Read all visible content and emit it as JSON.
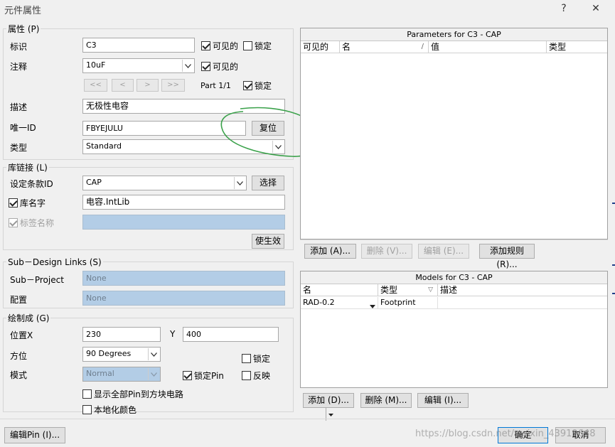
{
  "window": {
    "title": "元件属性",
    "help": "?",
    "close": "✕"
  },
  "properties": {
    "group_label": "属性 (P)",
    "designator_label": "标识",
    "designator_value": "C3",
    "visible1_label": "可见的",
    "visible1_checked": true,
    "locked1_label": "锁定",
    "locked1_checked": false,
    "comment_label": "注释",
    "comment_value": "10uF",
    "visible2_label": "可见的",
    "visible2_checked": true,
    "nav_first": "<<",
    "nav_prev": "<",
    "nav_next": ">",
    "nav_last": ">>",
    "part_label": "Part 1/1",
    "locked2_label": "锁定",
    "locked2_checked": true,
    "description_label": "描述",
    "description_value": "无极性电容",
    "uid_label": "唯一ID",
    "uid_value": "FBYEJULU",
    "reset_button": "复位",
    "type_label": "类型",
    "type_value": "Standard"
  },
  "library": {
    "group_label": "库链接 (L)",
    "design_id_label": "设定条款ID",
    "design_id_value": "CAP",
    "choose_button": "选择",
    "libname_label": "库名字",
    "libname_checked": true,
    "libname_value": "电容.IntLib",
    "tagname_label": "标签名称",
    "tagname_checked": true,
    "apply_button": "使生效"
  },
  "subdesign": {
    "group_label": "Sub－Design Links (S)",
    "subproject_label": "Sub－Project",
    "subproject_value": "None",
    "config_label": "配置",
    "config_value": "None"
  },
  "graphical": {
    "group_label": "绘制成 (G)",
    "location_x_label": "位置X",
    "location_x_value": "230",
    "y_label": "Y",
    "y_value": "400",
    "orientation_label": "方位",
    "orientation_value": "90 Degrees",
    "locked_label": "锁定",
    "locked_checked": false,
    "mode_label": "模式",
    "mode_value": "Normal",
    "lockpins_label": "锁定Pin",
    "lockpins_checked": true,
    "mirrored_label": "反映",
    "mirrored_checked": false,
    "show_pins_label": "显示全部Pin到方块电路",
    "show_pins_checked": false,
    "local_colors_label": "本地化颜色",
    "local_colors_checked": false
  },
  "parameters": {
    "title": "Parameters for C3 - CAP",
    "columns": [
      "可见的",
      "名",
      "值",
      "类型"
    ],
    "sort_mark": "/",
    "add": "添加 (A)...",
    "remove": "删除 (V)...",
    "edit": "编辑 (E)...",
    "add_rule": "添加规则 (R)..."
  },
  "models": {
    "title": "Models for C3 - CAP",
    "columns": [
      "名",
      "类型",
      "描述"
    ],
    "sort_mark": "▽",
    "rows": [
      {
        "name": "RAD-0.2",
        "type": "Footprint",
        "desc": ""
      }
    ],
    "add": "添加 (D)...",
    "remove": "删除 (M)...",
    "edit": "编辑 (I)..."
  },
  "footer": {
    "edit_pins": "编辑Pin (I)...",
    "ok": "确定",
    "cancel": "取消",
    "watermark": "https://blog.csdn.net/weixin_43919648"
  },
  "colors": {
    "disabled_field": "#b3cde6",
    "annotation": "#3aa14a"
  }
}
